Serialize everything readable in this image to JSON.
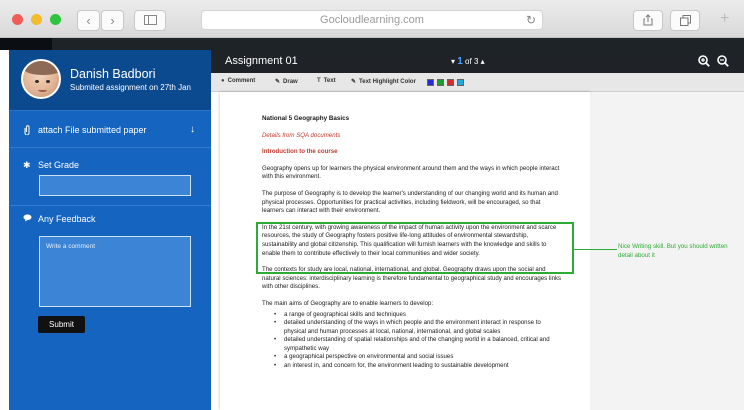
{
  "browser": {
    "url": "Gocloudlearning.com",
    "traffic_lights": [
      "#ee5e57",
      "#f2bc2e",
      "#2fc43f"
    ],
    "back_icon": "chevron-left-icon",
    "forward_icon": "chevron-right-icon",
    "sidebar_icon": "sidebar-icon",
    "share_icon": "share-icon",
    "tabs_icon": "tabs-icon",
    "reload_icon": "reload-icon",
    "new_tab_icon": "plus-icon"
  },
  "student": {
    "name": "Danish Badbori",
    "status": "Submited assignment on 27th Jan"
  },
  "sidebar": {
    "attach_label": "attach File submitted paper",
    "grade_label": "Set Grade",
    "feedback_label": "Any Feedback",
    "feedback_placeholder": "Write a comment",
    "submit_label": "Submit"
  },
  "viewer": {
    "title": "Assignment 01",
    "page_current": "1",
    "page_of": "of 3",
    "tools": {
      "comment": "Comment",
      "draw": "Draw",
      "text": "Text",
      "highlight": "Text Highlight Color"
    },
    "highlight_colors": [
      "#2b2bd6",
      "#1f9c33",
      "#d92b2b",
      "#27a6d9"
    ],
    "accent": "#2eab35"
  },
  "document": {
    "title": "National 5 Geography Basics",
    "source": "Details from SQA documents",
    "intro_heading": "Introduction to the course",
    "p1": "Geography opens up for learners the physical environment around them and the ways in which people interact with this environment.",
    "p2": "The purpose of Geography is to develop the learner's understanding of our changing world and its human and physical processes. Opportunities for practical activities, including fieldwork, will be encouraged, so that learners can interact with their environment.",
    "p3": "In the 21st century, with growing awareness of the impact of human activity upon the environment and scarce resources, the study of Geography fosters positive life-long attitudes of environmental stewardship, sustainability and global citizenship. This qualification will furnish learners with the knowledge and skills to enable them to contribute effectively to their local communities and wider society.",
    "p4": "The contexts for study are local, national, international, and global. Geography draws upon the social and natural sciences: interdisciplinary learning is therefore fundamental to geographical study and encourages links with other disciplines.",
    "p5": "The main aims of Geography are to enable learners to develop:",
    "bullets": [
      "a range of geographical skills and techniques",
      "detailed understanding of the ways in which people and the environment interact in response to physical and human processes at local, national, international, and global scales",
      "detailed understanding of spatial relationships and of the changing world in a balanced, critical and sympathetic way",
      "a geographical perspective on environmental and social issues",
      "an interest in, and concern for, the environment leading to sustainable development"
    ]
  },
  "annotation": {
    "comment": "Nice Writing skill. But you should written detail about it"
  }
}
